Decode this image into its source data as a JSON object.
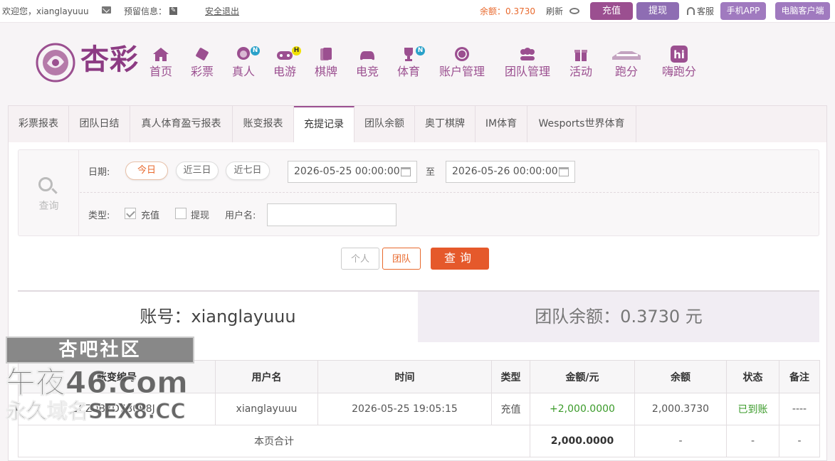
{
  "topbar": {
    "welcome": "欢迎您，xianglayuuu",
    "reserve": "预留信息：",
    "logout": "安全退出",
    "balance": "余额：0.3730",
    "refresh": "刷新",
    "recharge": "充值",
    "withdraw": "提现",
    "service": "客服",
    "app": "手机APP",
    "pc_client": "电脑客户端"
  },
  "logo": {
    "text": "杏彩"
  },
  "nav": [
    {
      "label": "首页",
      "icon": "home-icon"
    },
    {
      "label": "彩票",
      "icon": "lottery-icon"
    },
    {
      "label": "真人",
      "icon": "live-dealer-icon",
      "badge": "N"
    },
    {
      "label": "电游",
      "icon": "gamepad-icon",
      "badge": "H"
    },
    {
      "label": "棋牌",
      "icon": "cards-icon"
    },
    {
      "label": "电竞",
      "icon": "esports-icon"
    },
    {
      "label": "体育",
      "icon": "trophy-icon",
      "badge": "N"
    },
    {
      "label": "账户管理",
      "icon": "coin-icon"
    },
    {
      "label": "团队管理",
      "icon": "team-icon"
    },
    {
      "label": "活动",
      "icon": "gift-icon"
    },
    {
      "label": "跑分",
      "icon": "runner-icon"
    },
    {
      "label": "嗨跑分",
      "icon": "hi-icon"
    }
  ],
  "tabs": [
    "彩票报表",
    "团队日结",
    "真人体育盈亏报表",
    "账变报表",
    "充提记录",
    "团队余额",
    "奥丁棋牌",
    "IM体育",
    "Wesports世界体育"
  ],
  "filter": {
    "side_label": "查询",
    "date_label": "日期:",
    "quick_dates": [
      "今日",
      "近三日",
      "近七日"
    ],
    "date_from": "2026-05-25 00:00:00",
    "to_label": "至",
    "date_to": "2026-05-26 00:00:00",
    "type_label": "类型:",
    "type_recharge": "充值",
    "type_withdraw": "提现",
    "username_label": "用户名:",
    "username_value": ""
  },
  "buttons": {
    "personal": "个人",
    "team": "团队",
    "query": "查询"
  },
  "summary": {
    "account": "账号：xianglayuuu",
    "team_balance": "团队余额：0.3730 元"
  },
  "table": {
    "headers": [
      "账变编号",
      "用户名",
      "时间",
      "类型",
      "金额/元",
      "余额",
      "状态",
      "备注"
    ],
    "row": {
      "id": "CZ0B7D7B0B8J",
      "username": "xianglayuuu",
      "time": "2026-05-25 19:05:15",
      "type": "充值",
      "amount": "+2,000.0000",
      "balance": "2,000.3730",
      "status": "已到账",
      "remark": "----"
    },
    "footer": {
      "label": "本页合计",
      "amount": "2,000.0000",
      "balance": "-",
      "status": "-",
      "remark": "-"
    }
  },
  "watermark": {
    "line1": "杏吧社区",
    "line2": "午夜46.com",
    "line3": "永久域名SEX8.CC"
  },
  "colors": {
    "brand_purple": "#9b4f90",
    "accent_orange": "#e8692d",
    "success_green": "#3b9b2a"
  }
}
